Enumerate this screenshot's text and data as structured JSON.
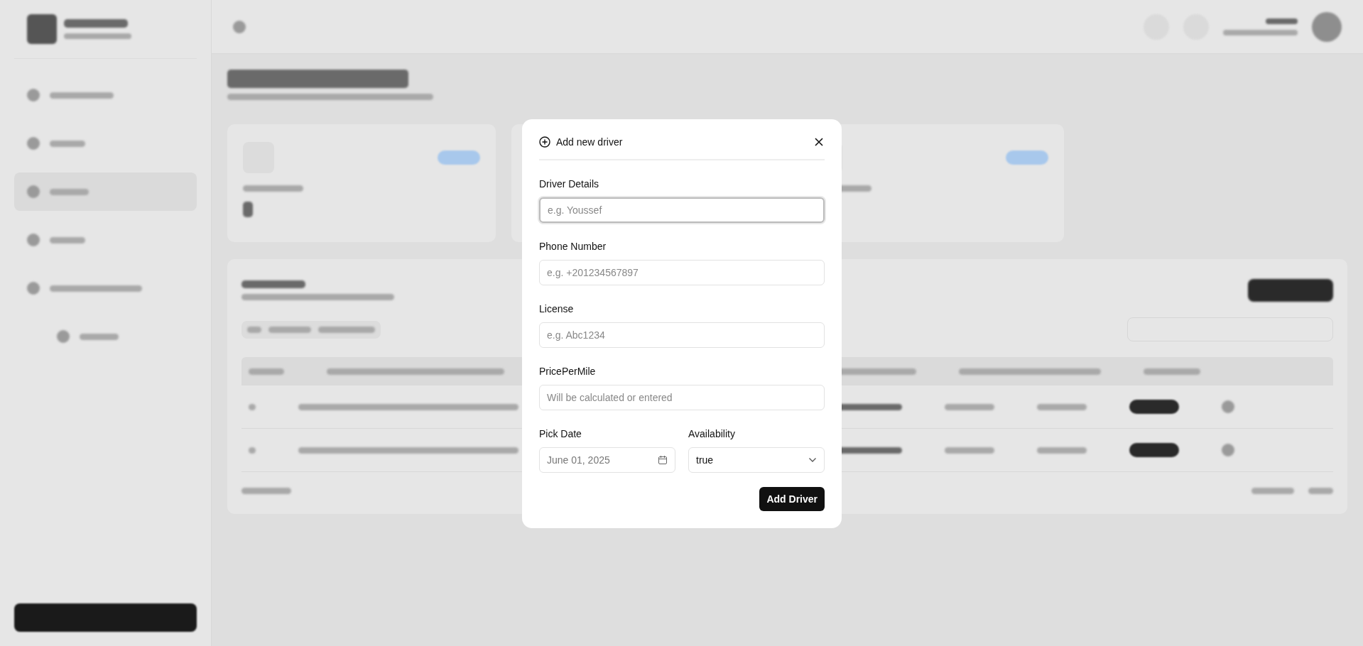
{
  "sidebar": {
    "items": [
      {
        "selected": false
      },
      {
        "selected": false
      },
      {
        "selected": true
      },
      {
        "selected": false
      },
      {
        "selected": false
      },
      {
        "selected": false
      }
    ]
  },
  "dialog": {
    "title": "Add new driver",
    "fields": [
      {
        "label": "Driver Details",
        "placeholder": "e.g. Youssef",
        "focused": true
      },
      {
        "label": "Phone Number",
        "placeholder": "e.g. +201234567897",
        "focused": false
      },
      {
        "label": "License",
        "placeholder": "e.g. Abc1234",
        "focused": false
      },
      {
        "label": "PricePerMile",
        "placeholder": "Will be calculated or entered",
        "focused": false
      }
    ],
    "date": {
      "label": "Pick Date",
      "placeholder": "June 01, 2025"
    },
    "availability": {
      "label": "Availability",
      "value": "true"
    },
    "submit": "Add Driver"
  }
}
